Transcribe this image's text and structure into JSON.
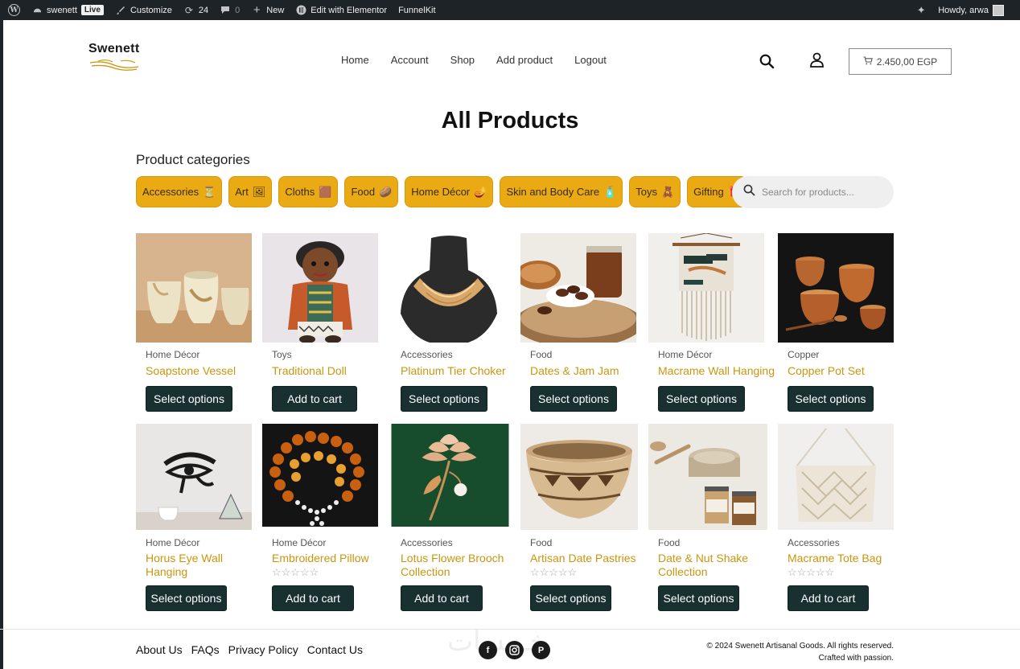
{
  "adminbar": {
    "site_name": "swenett",
    "live_badge": "Live",
    "customize": "Customize",
    "updates_count": "24",
    "comments_count": "0",
    "new": "New",
    "elementor": "Edit with Elementor",
    "funnelkit": "FunnelKit",
    "howdy": "Howdy, arwa"
  },
  "header": {
    "logo": "Swenett",
    "nav": [
      "Home",
      "Account",
      "Shop",
      "Add product",
      "Logout"
    ],
    "cart_total": "2.450,00 EGP"
  },
  "page_title": "All Products",
  "categories_heading": "Product categories",
  "categories": [
    {
      "label": "Accessories",
      "emoji": "⏳"
    },
    {
      "label": "Art",
      "emoji": "🖼"
    },
    {
      "label": "Cloths",
      "emoji": "🟫"
    },
    {
      "label": "Food",
      "emoji": "🥔"
    },
    {
      "label": "Home Décor",
      "emoji": "🪔"
    },
    {
      "label": "Skin and Body Care",
      "emoji": "🧴"
    },
    {
      "label": "Toys",
      "emoji": "🧸"
    },
    {
      "label": "Gifting",
      "emoji": "🎁"
    }
  ],
  "search": {
    "placeholder": "Search for products..."
  },
  "products": [
    {
      "category": "Home Décor",
      "name": "Soapstone Vessel",
      "button": "Select options",
      "image": "soapstone-vessels"
    },
    {
      "category": "Toys",
      "name": "Traditional Doll",
      "button": "Add to cart",
      "image": "traditional-doll"
    },
    {
      "category": "Accessories",
      "name": "Platinum Tier Choker",
      "button": "Select options",
      "image": "choker-necklace"
    },
    {
      "category": "Food",
      "name": "Dates & Jam Jam",
      "button": "Select options",
      "image": "dates-and-jam"
    },
    {
      "category": "Home Décor",
      "name": "Macrame Wall Hanging",
      "button": "Select options",
      "image": "wall-hanging"
    },
    {
      "category": "Copper",
      "name": "Copper Pot Set",
      "button": "Select options",
      "image": "copper-pots"
    },
    {
      "category": "Home Décor",
      "name": "Horus Eye Wall Hanging",
      "button": "Select options",
      "image": "horus-eye"
    },
    {
      "category": "Home Décor",
      "name": "Embroidered Pillow",
      "button": "Add to cart",
      "image": "amber-beads",
      "rating": "☆☆☆☆☆"
    },
    {
      "category": "Accessories",
      "name": "Lotus Flower Brooch Collection",
      "button": "Add to cart",
      "image": "lotus-brooch"
    },
    {
      "category": "Food",
      "name": "Artisan Date Pastries",
      "button": "Select options",
      "image": "woven-basket",
      "rating": "☆☆☆☆☆"
    },
    {
      "category": "Food",
      "name": "Date & Nut Shake Collection",
      "button": "Select options",
      "image": "skin-jars"
    },
    {
      "category": "Accessories",
      "name": "Macrame Tote Bag",
      "button": "Add to cart",
      "image": "macrame-bag",
      "rating": "☆☆☆☆☆"
    }
  ],
  "footer": {
    "links": [
      "About Us",
      "FAQs",
      "Privacy Policy",
      "Contact Us"
    ],
    "social": [
      "facebook-icon",
      "instagram-icon",
      "pinterest-icon"
    ],
    "copyright": "© 2024 Swenett Artisanal Goods. All rights reserved.",
    "tagline": "Crafted with passion."
  },
  "colors": {
    "accent": "#e9aa13",
    "button": "#183030",
    "product_name": "#c9960f",
    "adminbar": "#1d2327"
  }
}
